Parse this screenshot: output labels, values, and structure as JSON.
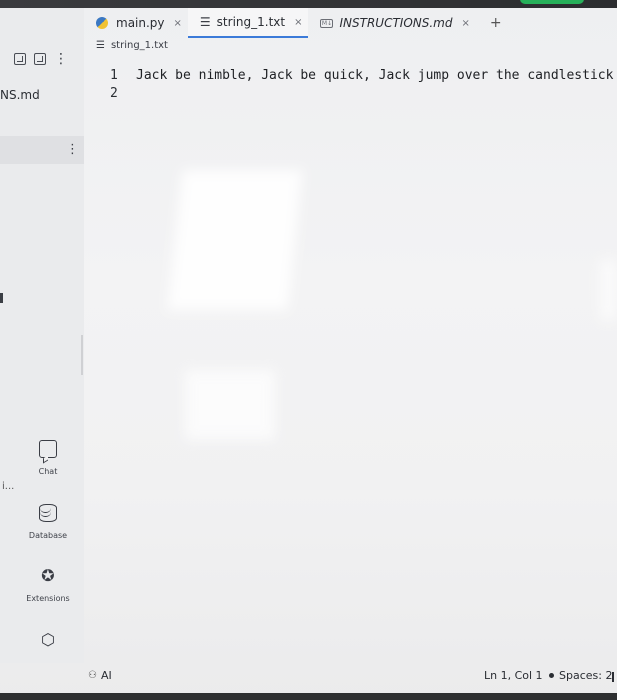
{
  "tabs": [
    {
      "label": "main.py",
      "close": "×"
    },
    {
      "label": "string_1.txt",
      "close": "×"
    },
    {
      "label": "INSTRUCTIONS.md",
      "close": "×"
    }
  ],
  "new_tab": "+",
  "breadcrumb": "string_1.txt",
  "sidebar": {
    "file_label": "NS.md",
    "truncated": "i...",
    "chat": "Chat",
    "database": "Database",
    "extensions": "Extensions"
  },
  "editor": {
    "lines": [
      {
        "number": "1",
        "text": "Jack be nimble, Jack be quick, Jack jump over the candlestick"
      },
      {
        "number": "2",
        "text": ""
      }
    ]
  },
  "status": {
    "ai": "AI",
    "position": "Ln 1, Col 1",
    "spaces": "Spaces: 2"
  },
  "icons": {
    "new-file": "new-file-icon",
    "new-folder": "new-folder-icon",
    "chat": "chat-icon",
    "database": "database-icon",
    "extensions": "extensions-icon",
    "packages": "package-icon"
  },
  "colors": {
    "active_tab_border": "#3c7bd9",
    "top_pill": "#27b05a"
  }
}
